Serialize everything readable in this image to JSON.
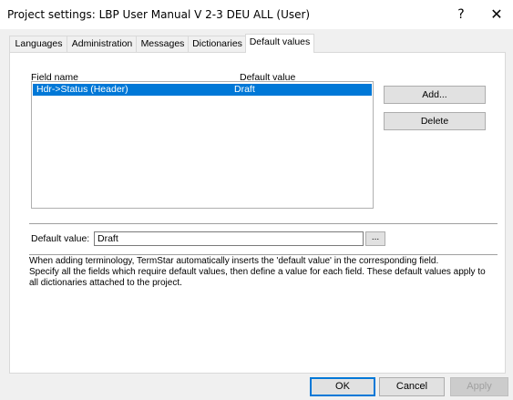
{
  "window": {
    "title": "Project settings: LBP User Manual V 2-3 DEU ALL (User)",
    "help_glyph": "?",
    "close_glyph": "✕"
  },
  "tabs": [
    {
      "label": "Languages",
      "active": false
    },
    {
      "label": "Administration",
      "active": false
    },
    {
      "label": "Messages",
      "active": false
    },
    {
      "label": "Dictionaries",
      "active": false
    },
    {
      "label": "Default values",
      "active": true
    }
  ],
  "list": {
    "col_field": "Field name",
    "col_default": "Default value",
    "rows": [
      {
        "field": "Hdr->Status (Header)",
        "value": "Draft",
        "selected": true
      }
    ]
  },
  "buttons": {
    "add": "Add...",
    "delete": "Delete",
    "browse": "...",
    "ok": "OK",
    "cancel": "Cancel",
    "apply": "Apply"
  },
  "default_value": {
    "label": "Default value:",
    "value": "Draft"
  },
  "description": {
    "line1": "When adding terminology, TermStar automatically inserts the 'default value' in the corresponding field.",
    "line2": "Specify all the fields which require default values, then define a value for each field. These default values apply to all dictionaries attached to the project."
  },
  "colors": {
    "selection": "#0078d7",
    "dialog_bg": "#f0f0f0",
    "ok_border": "#0078d7"
  }
}
